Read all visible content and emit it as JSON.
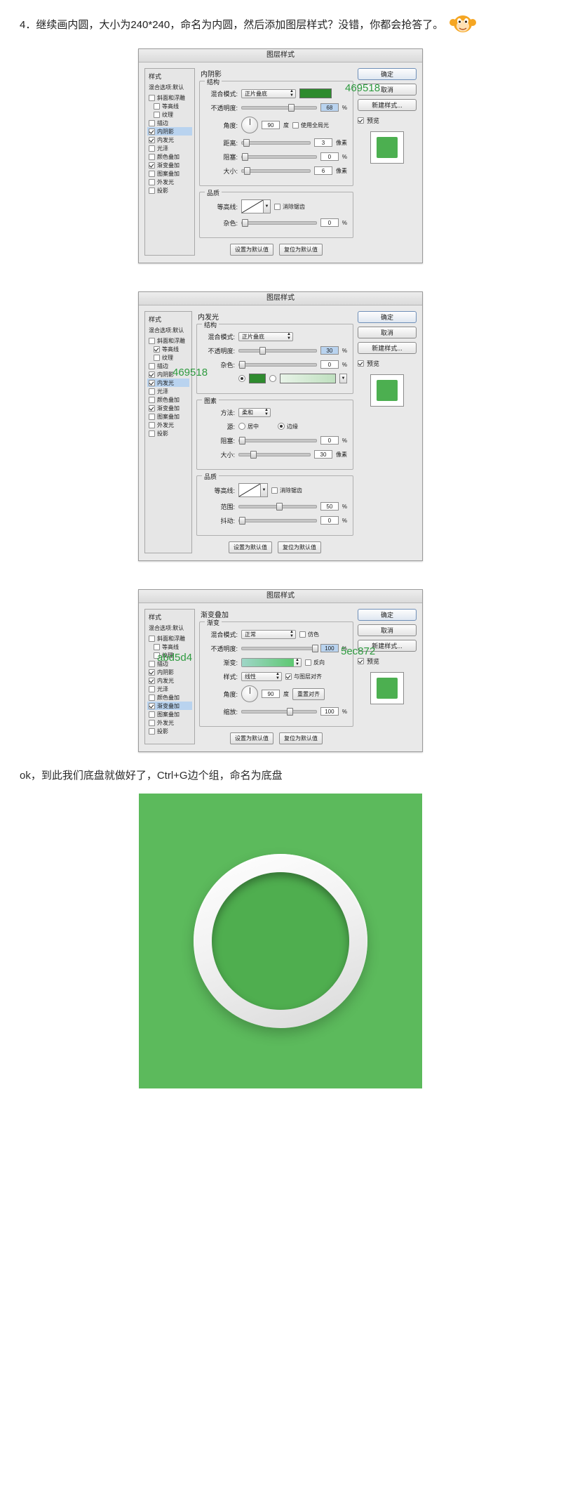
{
  "intro": {
    "text": "4．继续画内圆，大小为240*240，命名为内圆，然后添加图层样式？没错，你都会抢答了。",
    "emoji_name": "monkey-emoji"
  },
  "styles_list": {
    "header": "样式",
    "blend_label": "混合选项:默认",
    "items": [
      {
        "label": "斜面和浮雕",
        "checked": false,
        "indent": false,
        "selected": false
      },
      {
        "label": "等高线",
        "checked": false,
        "indent": true,
        "selected": false
      },
      {
        "label": "纹理",
        "checked": false,
        "indent": true,
        "selected": false
      },
      {
        "label": "描边",
        "checked": false,
        "indent": false,
        "selected": false
      },
      {
        "label": "内阴影",
        "checked": true,
        "indent": false,
        "selected": true
      },
      {
        "label": "内发光",
        "checked": true,
        "indent": false,
        "selected": false
      },
      {
        "label": "光泽",
        "checked": false,
        "indent": false,
        "selected": false
      },
      {
        "label": "颜色叠加",
        "checked": false,
        "indent": false,
        "selected": false
      },
      {
        "label": "渐变叠加",
        "checked": true,
        "indent": false,
        "selected": false
      },
      {
        "label": "图案叠加",
        "checked": false,
        "indent": false,
        "selected": false
      },
      {
        "label": "外发光",
        "checked": false,
        "indent": false,
        "selected": false
      },
      {
        "label": "投影",
        "checked": false,
        "indent": false,
        "selected": false
      }
    ]
  },
  "buttons": {
    "ok": "确定",
    "cancel": "取消",
    "new_style": "新建样式...",
    "preview": "预览",
    "set_default": "设置为默认值",
    "reset_default": "复位为默认值"
  },
  "dialog_title": "图层样式",
  "dialog1": {
    "section_title": "内阴影",
    "group_structure": "结构",
    "group_quality": "品质",
    "blend_mode_label": "混合模式:",
    "blend_mode_value": "正片叠底",
    "color_hex": "469518",
    "opacity_label": "不透明度:",
    "opacity_value": "68",
    "opacity_unit": "%",
    "angle_label": "角度:",
    "angle_value": "90",
    "angle_unit": "度",
    "global_light_label": "使用全局光",
    "distance_label": "距离:",
    "distance_value": "3",
    "distance_unit": "像素",
    "choke_label": "阻塞:",
    "choke_value": "0",
    "choke_unit": "%",
    "size_label": "大小:",
    "size_value": "6",
    "size_unit": "像素",
    "contour_label": "等高线:",
    "antialias_label": "消除锯齿",
    "noise_label": "杂色:",
    "noise_value": "0",
    "noise_unit": "%"
  },
  "dialog2": {
    "section_title": "内发光",
    "group_structure": "结构",
    "group_elements": "图素",
    "group_quality": "品质",
    "blend_mode_label": "混合模式:",
    "blend_mode_value": "正片叠底",
    "opacity_label": "不透明度:",
    "opacity_value": "30",
    "opacity_unit": "%",
    "noise_label": "杂色:",
    "noise_value": "0",
    "noise_unit": "%",
    "color_hex": "469518",
    "method_label": "方法:",
    "method_value": "柔和",
    "source_label": "源:",
    "source_center": "居中",
    "source_edge": "边缘",
    "choke_label": "阻塞:",
    "choke_value": "0",
    "choke_unit": "%",
    "size_label": "大小:",
    "size_value": "30",
    "size_unit": "像素",
    "contour_label": "等高线:",
    "antialias_label": "消除锯齿",
    "range_label": "范围:",
    "range_value": "50",
    "range_unit": "%",
    "jitter_label": "抖动:",
    "jitter_value": "0",
    "jitter_unit": "%"
  },
  "dialog3": {
    "section_title": "渐变叠加",
    "group_gradient": "渐变",
    "blend_mode_label": "混合模式:",
    "blend_mode_value": "正常",
    "dither_label": "仿色",
    "opacity_label": "不透明度:",
    "opacity_value": "100",
    "opacity_unit": "%",
    "gradient_label": "渐变:",
    "reverse_label": "反向",
    "style_label": "样式:",
    "style_value": "线性",
    "align_label": "与图层对齐",
    "angle_label": "角度:",
    "angle_value": "90",
    "angle_unit": "度",
    "reset_align_label": "重置对齐",
    "scale_label": "缩放:",
    "scale_value": "100",
    "scale_unit": "%",
    "hex_left": "abd5d4",
    "hex_right": "5ec872"
  },
  "caption": "ok，到此我们底盘就做好了，Ctrl+G边个组，命名为底盘",
  "colors": {
    "hex_annotation": "#2e9b3f",
    "sample_green": "#469518",
    "art_background": "#5cba5c"
  }
}
